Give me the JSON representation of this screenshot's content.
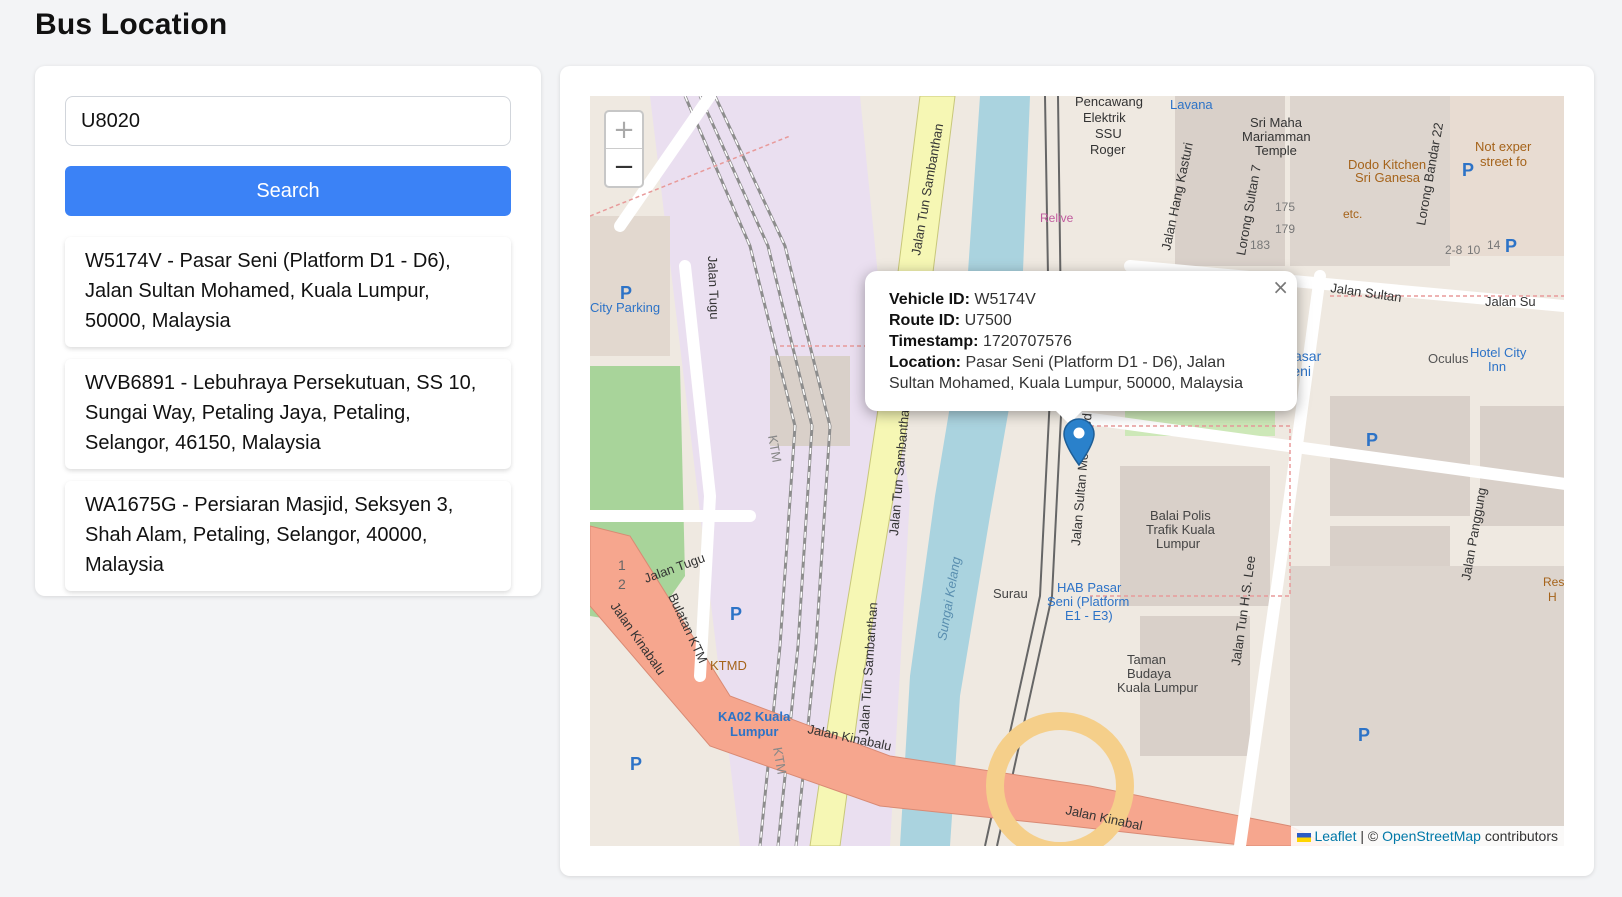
{
  "page": {
    "title": "Bus Location"
  },
  "search": {
    "value": "U8020",
    "button_label": "Search"
  },
  "results": [
    {
      "text": "W5174V - Pasar Seni (Platform D1 - D6), Jalan Sultan Mohamed, Kuala Lumpur, 50000, Malaysia"
    },
    {
      "text": "WVB6891 - Lebuhraya Persekutuan, SS 10, Sungai Way, Petaling Jaya, Petaling, Selangor, 46150, Malaysia"
    },
    {
      "text": "WA1675G - Persiaran Masjid, Seksyen 3, Shah Alam, Petaling, Selangor, 40000, Malaysia"
    }
  ],
  "map": {
    "zoom_in": "+",
    "zoom_out": "−",
    "popup": {
      "close": "×",
      "vehicle_label": "Vehicle ID:",
      "vehicle_value": "W5174V",
      "route_label": "Route ID:",
      "route_value": "U7500",
      "timestamp_label": "Timestamp:",
      "timestamp_value": "1720707576",
      "location_label": "Location:",
      "location_value": "Pasar Seni (Platform D1 - D6), Jalan Sultan Mohamed, Kuala Lumpur, 50000, Malaysia"
    },
    "attribution": {
      "leaflet": "Leaflet",
      "separator": " | © ",
      "osm": "OpenStreetMap",
      "suffix": " contributors"
    },
    "labels": {
      "pencawang": "Pencawang",
      "elektrik": "Elektrik",
      "ssu": "SSU",
      "roger": "Roger",
      "lavana": "Lavana",
      "sri_maha": "Sri Maha",
      "mariamman": "Mariamman",
      "temple": "Temple",
      "dodo": "Dodo Kitchen",
      "sri_ganesa": "Sri Ganesa",
      "not_exp": "Not exper",
      "street_fo": "street fo",
      "lorong_bandar": "Lorong Bandar 22",
      "lorong_sultan": "Lorong Sultan 7",
      "jalan_hang_kasturi": "Jalan Hang Kasturi",
      "jalan_tun_s1": "Jalan Tun Sambanthan",
      "jalan_tun_s2": "Jalan Tun Sambanthan",
      "jalan_tun_s3": "Jalan Tun Sambanthan",
      "jalan_tugu1": "Jalan Tugu",
      "jalan_tugu2": "Jalan Tugu",
      "city_parking": "City Parking",
      "jalan_sultan": "Jalan Sultan",
      "jalan_su": "Jalan Su",
      "oculus": "Oculus",
      "hotel_city": "Hotel City",
      "inn": "Inn",
      "pasar_seni_1": "6 Pasar",
      "pasar_seni_2": "Seni",
      "balai1": "Balai Polis",
      "balai2": "Trafik Kuala",
      "balai3": "Lumpur",
      "jalan_sultan_mohamed": "Jalan Sultan Mohamed",
      "surau": "Surau",
      "hab1": "HAB Pasar",
      "hab2": "Seni (Platform",
      "hab3": "E1 - E3)",
      "taman1": "Taman",
      "taman2": "Budaya",
      "taman3": "Kuala Lumpur",
      "jalan_tun_hs_lee": "Jalan Tun H.S. Lee",
      "jalan_panggung": "Jalan Panggung",
      "sungai_kelang": "Sungai Kelang",
      "jalan_kinabalu1": "Jalan Kinabalu",
      "jalan_kinabalu2": "Jalan Kinabalu",
      "jalan_kinabalu3": "Jalan Kinabal",
      "bulatan_ktm": "Bulatan KTM",
      "ktmd": "KTMD",
      "ka02_1": "KA02 Kuala",
      "ka02_2": "Lumpur",
      "ktm1": "KTM",
      "ktm2": "KTM",
      "n175": "175",
      "n179": "179",
      "n183": "183",
      "n28": "2-8",
      "n10": "10",
      "n14": "14",
      "etc": "etc.",
      "relive": "Relive",
      "res": "Res",
      "ha": "H",
      "p": "P",
      "bulatan_2": "2",
      "bulatan_1": "1"
    }
  }
}
